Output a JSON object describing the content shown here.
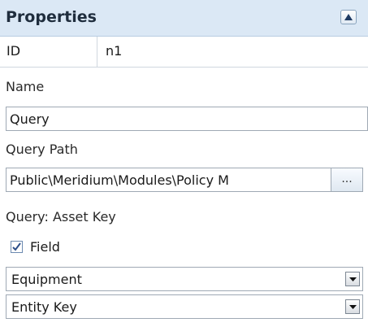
{
  "panel": {
    "title": "Properties",
    "collapse_icon": "triangle-up-icon"
  },
  "id_row": {
    "key": "ID",
    "value": "n1"
  },
  "name": {
    "label": "Name",
    "value": "Query"
  },
  "query_path": {
    "label": "Query Path",
    "value": "Public\\Meridium\\Modules\\Policy M",
    "browse_label": "..."
  },
  "asset_key": {
    "label": "Query: Asset Key",
    "field_checkbox": {
      "label": "Field",
      "checked": true
    },
    "family_select": {
      "value": "Equipment",
      "icon": "chevron-down-icon"
    },
    "field_select": {
      "value": "Entity Key",
      "icon": "chevron-down-icon"
    }
  },
  "colors": {
    "header_bg": "#dbe8f5",
    "border": "#9fa9b4",
    "accent": "#6c8ab0"
  }
}
